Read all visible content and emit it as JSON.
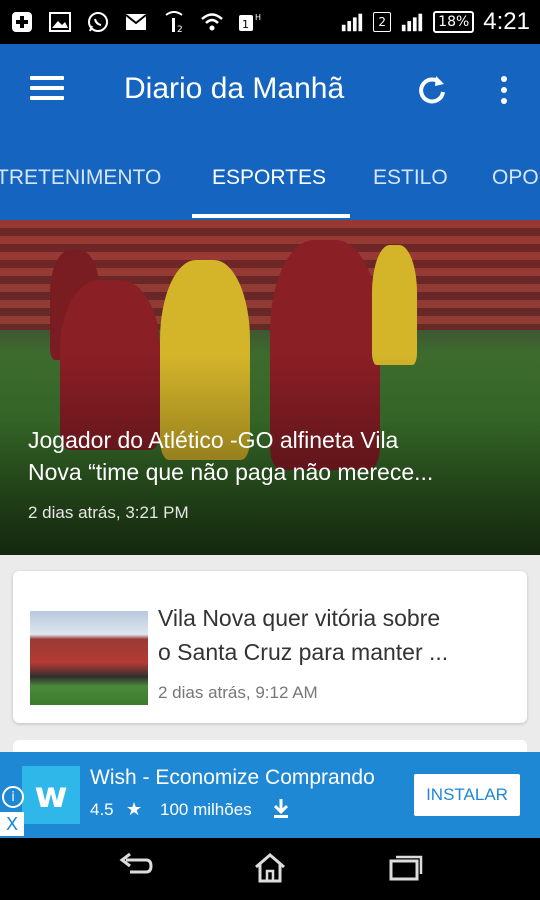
{
  "statusbar": {
    "battery": "18%",
    "clock": "4:21",
    "sim2": "2"
  },
  "appbar": {
    "title": "Diario da Manhã"
  },
  "tabs": [
    {
      "label": "TRETENIMENTO",
      "active": false
    },
    {
      "label": "ESPORTES",
      "active": true
    },
    {
      "label": "ESTILO",
      "active": false
    },
    {
      "label": "OPO",
      "active": false
    }
  ],
  "hero": {
    "title_line1": "Jogador do Atlético -GO alfineta Vila",
    "title_line2": "Nova “time que não paga não merece...",
    "time": "2 dias atrás, 3:21 PM"
  },
  "card": {
    "title_line1": "Vila Nova quer vitória sobre",
    "title_line2": "o Santa Cruz para manter ...",
    "time": "2 dias atrás, 9:12 AM"
  },
  "ad": {
    "logo_letter": "w",
    "title": "Wish - Economize Comprando",
    "rating": "4.5",
    "downloads": "100 milhões",
    "install": "INSTALAR",
    "info": "i",
    "close": "X"
  }
}
